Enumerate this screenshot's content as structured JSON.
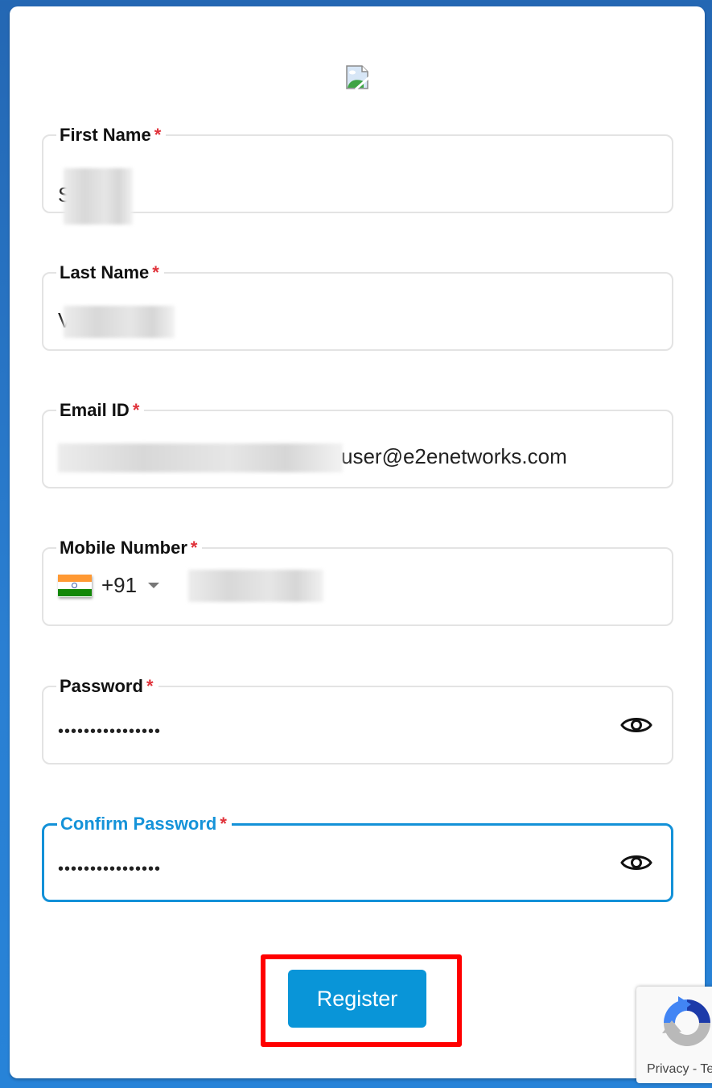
{
  "page": {
    "logo_icon": "broken-image-icon"
  },
  "form": {
    "fields": [
      {
        "id": "first_name",
        "label": "First Name",
        "required_mark": "*",
        "value_visible": "S",
        "value_redacted": true
      },
      {
        "id": "last_name",
        "label": "Last Name",
        "required_mark": "*",
        "value_visible": "V",
        "value_redacted": true
      },
      {
        "id": "email",
        "label": "Email ID",
        "required_mark": "*",
        "value_visible": "user@e2enetworks.com",
        "value_redacted": true
      },
      {
        "id": "mobile",
        "label": "Mobile Number",
        "required_mark": "*",
        "country_flag": "india-flag-icon",
        "dial_code": "+91",
        "value_redacted": true
      },
      {
        "id": "password",
        "label": "Password",
        "required_mark": "*",
        "value_masked": "••••••••••••••••",
        "toggle_icon": "eye-icon"
      },
      {
        "id": "confirm_password",
        "label": "Confirm Password",
        "required_mark": "*",
        "value_masked": "••••••••••••••••",
        "toggle_icon": "eye-icon",
        "focused": true
      }
    ],
    "submit_label": "Register"
  },
  "recaptcha": {
    "links_text": "Privacy - Terms"
  },
  "colors": {
    "accent": "#0995d8",
    "focus_border": "#1391d8",
    "required": "#e0323a",
    "highlight_box": "#ff0000",
    "background": "#2467b3"
  }
}
